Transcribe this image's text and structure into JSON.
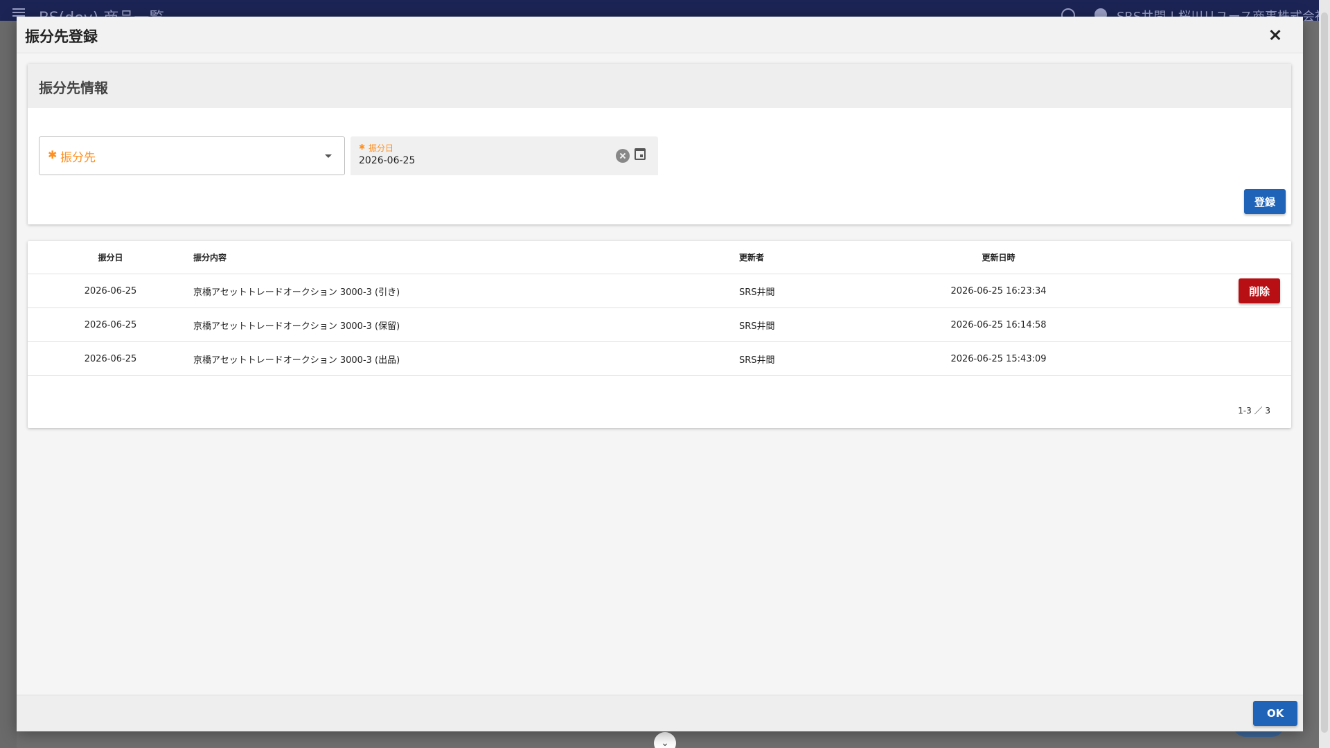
{
  "background": {
    "app_title": "BS(dev) 商品一覧",
    "user_name": "SRS井間 | 桜川リユース商事株式会社"
  },
  "modal": {
    "title": "振分先登録",
    "form_card": {
      "title": "振分先情報",
      "destination_select": {
        "required_mark": "✱",
        "label": "振分先",
        "value": ""
      },
      "date_field": {
        "required_mark": "✱",
        "label": "振分日",
        "value": "2026-06-25"
      },
      "register_label": "登録"
    },
    "table": {
      "columns": [
        "振分日",
        "振分内容",
        "更新者",
        "更新日時"
      ],
      "rows": [
        {
          "date": "2026-06-25",
          "content": "京橋アセットトレードオークション 3000-3 (引き)",
          "user": "SRS井間",
          "updated": "2026-06-25 16:23:34",
          "action": "削除"
        },
        {
          "date": "2026-06-25",
          "content": "京橋アセットトレードオークション 3000-3 (保留)",
          "user": "SRS井間",
          "updated": "2026-06-25 16:14:58",
          "action": ""
        },
        {
          "date": "2026-06-25",
          "content": "京橋アセットトレードオークション 3000-3 (出品)",
          "user": "SRS井間",
          "updated": "2026-06-25 15:43:09",
          "action": ""
        }
      ],
      "pagination": "1-3 ／ 3"
    },
    "ok_label": "OK"
  },
  "colors": {
    "primary": "#1e63b8",
    "danger": "#b80f14",
    "required": "#ff8f1f",
    "topbar": "#1b2454"
  },
  "icons": {
    "close": "close-icon",
    "dropdown": "chevron-down-icon",
    "clear": "clear-icon",
    "calendar": "calendar-icon"
  }
}
